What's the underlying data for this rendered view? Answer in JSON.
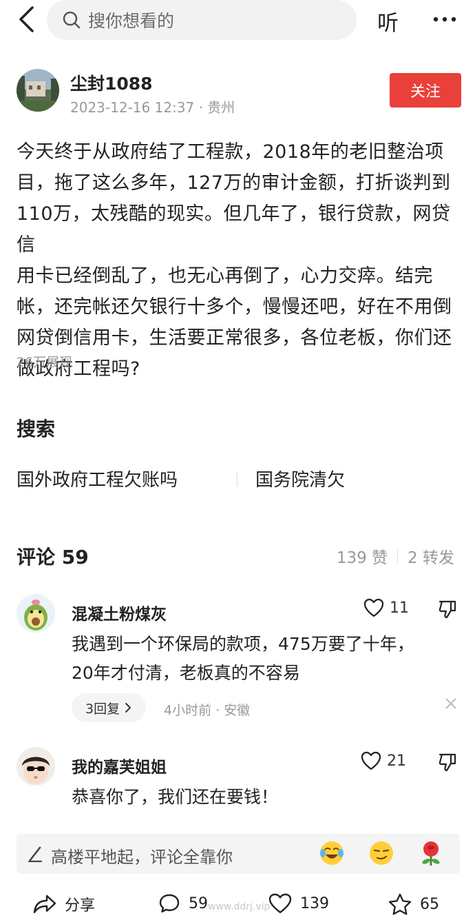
{
  "search": {
    "placeholder": "搜你想看的",
    "listen_label": "听"
  },
  "author": {
    "name": "尘封1088",
    "meta": "2023-12-16 12:37 · 贵州",
    "follow_label": "关注"
  },
  "post": {
    "lines": [
      "今天终于从政府结了工程款，2018年的老旧整治项",
      "目，拖了这么多年，127万的审计金额，打折谈判到",
      "110万，太残酷的现实。但几年了，银行贷款，网贷信",
      "用卡已经倒乱了，也无心再倒了，心力交瘁。结完",
      "帐，还完帐还欠银行十多个，慢慢还吧，好在不用倒",
      "网贷倒信用卡，生活要正常很多，各位老板，你们还",
      "做政府工程吗?"
    ],
    "views": "26万展现"
  },
  "search_section": {
    "title": "搜索",
    "links": [
      "国外政府工程欠账吗",
      "国务院清欠"
    ]
  },
  "comments": {
    "title": "评论 59",
    "likes": "139 赞",
    "shares": "2 转发",
    "items": [
      {
        "name": "混凝土粉煤灰",
        "like_count": "11",
        "text_lines": [
          "我遇到一个环保局的款项，475万要了十年，",
          "20年才付清，老板真的不容易"
        ],
        "reply_label": "3回复",
        "time": "4小时前 · 安徽"
      },
      {
        "name": "我的嘉芙姐姐",
        "like_count": "21",
        "text_lines": [
          "恭喜你了，我们还在要钱！"
        ]
      }
    ]
  },
  "input_bar": {
    "placeholder": "高楼平地起，评论全靠你"
  },
  "actions": {
    "share": "分享",
    "comments": "59",
    "likes": "139",
    "favorites": "65"
  },
  "watermark": "www.ddrj.vip",
  "colors": {
    "accent": "#e9403a",
    "muted": "#999999",
    "input_bg": "#f4f4f4"
  }
}
